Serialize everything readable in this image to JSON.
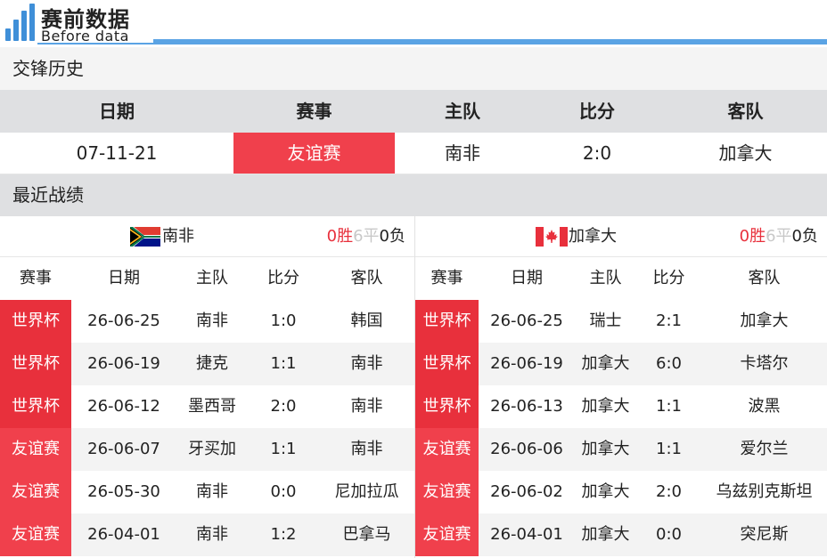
{
  "brand": {
    "title": "赛前数据",
    "subtitle": "Before data",
    "accent": "#5aa3e4"
  },
  "h2h": {
    "title": "交锋历史",
    "headers": {
      "date": "日期",
      "comp": "赛事",
      "home": "主队",
      "score": "比分",
      "away": "客队"
    },
    "match": {
      "date": "07-11-21",
      "comp": "友谊赛",
      "home": "南非",
      "score": "2:0",
      "away": "加拿大"
    }
  },
  "recent": {
    "title": "最近战绩",
    "headers": {
      "comp": "赛事",
      "date": "日期",
      "home": "主队",
      "score": "比分",
      "away": "客队"
    },
    "left": {
      "team": "南非",
      "flag": "south-africa-flag",
      "record": {
        "w": "0胜",
        "d": "6平",
        "l": "0负"
      },
      "matches": [
        {
          "comp": "世界杯",
          "date": "26-06-25",
          "home": "南非",
          "score": "1:0",
          "away": "韩国"
        },
        {
          "comp": "世界杯",
          "date": "26-06-19",
          "home": "捷克",
          "score": "1:1",
          "away": "南非"
        },
        {
          "comp": "世界杯",
          "date": "26-06-12",
          "home": "墨西哥",
          "score": "2:0",
          "away": "南非"
        },
        {
          "comp": "友谊赛",
          "date": "26-06-07",
          "home": "牙买加",
          "score": "1:1",
          "away": "南非"
        },
        {
          "comp": "友谊赛",
          "date": "26-05-30",
          "home": "南非",
          "score": "0:0",
          "away": "尼加拉瓜"
        },
        {
          "comp": "友谊赛",
          "date": "26-04-01",
          "home": "南非",
          "score": "1:2",
          "away": "巴拿马"
        }
      ]
    },
    "right": {
      "team": "加拿大",
      "flag": "canada-flag",
      "record": {
        "w": "0胜",
        "d": "6平",
        "l": "0负"
      },
      "matches": [
        {
          "comp": "世界杯",
          "date": "26-06-25",
          "home": "瑞士",
          "score": "2:1",
          "away": "加拿大"
        },
        {
          "comp": "世界杯",
          "date": "26-06-19",
          "home": "加拿大",
          "score": "6:0",
          "away": "卡塔尔"
        },
        {
          "comp": "世界杯",
          "date": "26-06-13",
          "home": "加拿大",
          "score": "1:1",
          "away": "波黑"
        },
        {
          "comp": "友谊赛",
          "date": "26-06-06",
          "home": "加拿大",
          "score": "1:1",
          "away": "爱尔兰"
        },
        {
          "comp": "友谊赛",
          "date": "26-06-02",
          "home": "加拿大",
          "score": "2:0",
          "away": "乌兹别克斯坦"
        },
        {
          "comp": "友谊赛",
          "date": "26-04-01",
          "home": "加拿大",
          "score": "0:0",
          "away": "突尼斯"
        }
      ]
    }
  }
}
